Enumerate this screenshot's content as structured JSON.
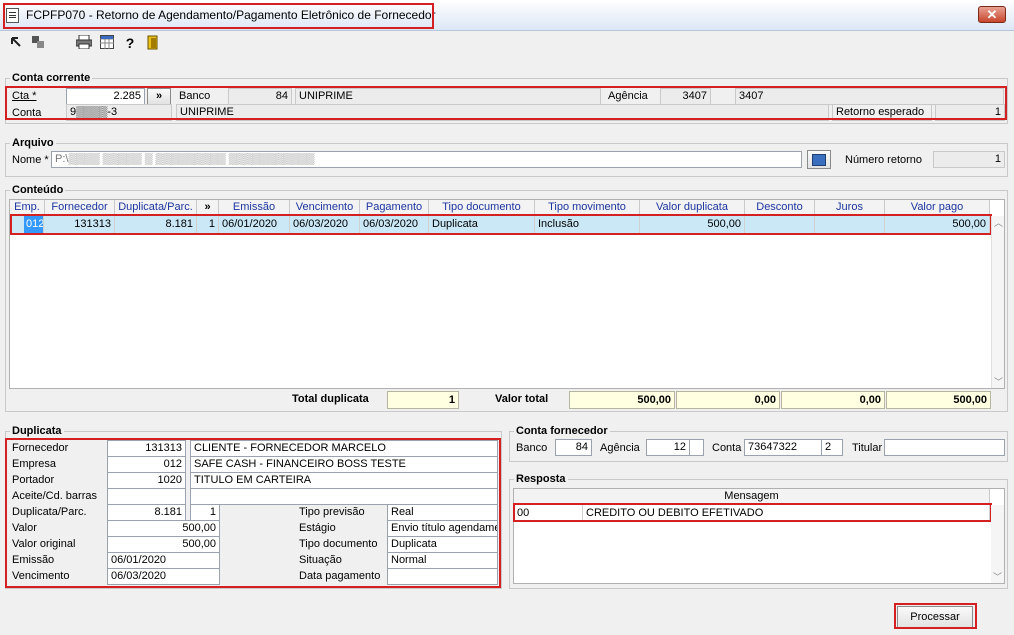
{
  "window": {
    "title": "FCPFP070 - Retorno de Agendamento/Pagamento Eletrônico de Fornecedor",
    "close_glyph": "✕"
  },
  "toolbar": {
    "icons": [
      "back-icon",
      "gear-icon",
      "print-icon",
      "calculator-icon",
      "help-icon",
      "exit-icon"
    ]
  },
  "conta_corrente": {
    "legend": "Conta corrente",
    "cta_label": "Cta *",
    "cta_value": "2.285",
    "expand_glyph": "»",
    "banco_label": "Banco",
    "banco_code": "84",
    "banco_name": "UNIPRIME",
    "agencia_label": "Agência",
    "agencia_code": "3407",
    "agencia_name": "3407",
    "conta_label": "Conta",
    "conta_value": "9▒▒▒▒-3",
    "conta_name": "UNIPRIME",
    "retorno_label": "Retorno esperado",
    "retorno_value": "1"
  },
  "arquivo": {
    "legend": "Arquivo",
    "nome_label": "Nome *",
    "nome_value": "P:\\▒▒▒▒ ▒▒▒▒▒ ▒ ▒▒▒▒▒▒▒▒▒ ▒▒▒▒▒▒▒▒▒▒▒",
    "numero_label": "Número retorno",
    "numero_value": "1"
  },
  "conteudo": {
    "legend": "Conteúdo",
    "columns": [
      "Emp.",
      "Fornecedor",
      "Duplicata/Parc.",
      "»",
      "Emissão",
      "Vencimento",
      "Pagamento",
      "Tipo documento",
      "Tipo movimento",
      "Valor duplicata",
      "Desconto",
      "Juros",
      "Valor pago"
    ],
    "rows": [
      {
        "emp": "012",
        "fornecedor": "131313",
        "duplicata": "8.181",
        "parc": "1",
        "emissao": "06/01/2020",
        "vencimento": "06/03/2020",
        "pagamento": "06/03/2020",
        "tipo_documento": "Duplicata",
        "tipo_movimento": "Inclusão",
        "valor_duplicata": "500,00",
        "desconto": "",
        "juros": "",
        "valor_pago": "500,00"
      }
    ],
    "total_duplicata_label": "Total duplicata",
    "total_duplicata_value": "1",
    "valor_total_label": "Valor total",
    "totals": [
      "500,00",
      "0,00",
      "0,00",
      "500,00"
    ]
  },
  "duplicata": {
    "legend": "Duplicata",
    "fornecedor_label": "Fornecedor",
    "fornecedor_code": "131313",
    "fornecedor_name": "CLIENTE - FORNECEDOR MARCELO",
    "empresa_label": "Empresa",
    "empresa_code": "012",
    "empresa_name": "SAFE CASH - FINANCEIRO BOSS TESTE",
    "portador_label": "Portador",
    "portador_code": "1020",
    "portador_name": "TITULO EM CARTEIRA",
    "aceite_label": "Aceite/Cd. barras",
    "aceite_value": "",
    "aceite_barcode": "",
    "dup_label": "Duplicata/Parc.",
    "dup_value": "8.181",
    "parc_value": "1",
    "valor_label": "Valor",
    "valor_value": "500,00",
    "valor_original_label": "Valor original",
    "valor_original_value": "500,00",
    "emissao_label": "Emissão",
    "emissao_value": "06/01/2020",
    "vencimento_label": "Vencimento",
    "vencimento_value": "06/03/2020",
    "tipo_previsao_label": "Tipo previsão",
    "tipo_previsao_value": "Real",
    "estagio_label": "Estágio",
    "estagio_value": "Envio título agendamento",
    "tipo_documento_label": "Tipo documento",
    "tipo_documento_value": "Duplicata",
    "situacao_label": "Situação",
    "situacao_value": "Normal",
    "data_pagamento_label": "Data pagamento",
    "data_pagamento_value": ""
  },
  "conta_fornecedor": {
    "legend": "Conta fornecedor",
    "banco_label": "Banco",
    "banco_value": "84",
    "agencia_label": "Agência",
    "agencia_value": "12",
    "agencia_dv": "",
    "conta_label": "Conta",
    "conta_value": "73647322",
    "conta_dv": "2",
    "titular_label": "Titular",
    "titular_value": ""
  },
  "resposta": {
    "legend": "Resposta",
    "header": "Mensagem",
    "rows": [
      {
        "code": "00",
        "message": "CREDITO OU DEBITO EFETIVADO"
      }
    ]
  },
  "actions": {
    "processar_label": "Processar"
  }
}
